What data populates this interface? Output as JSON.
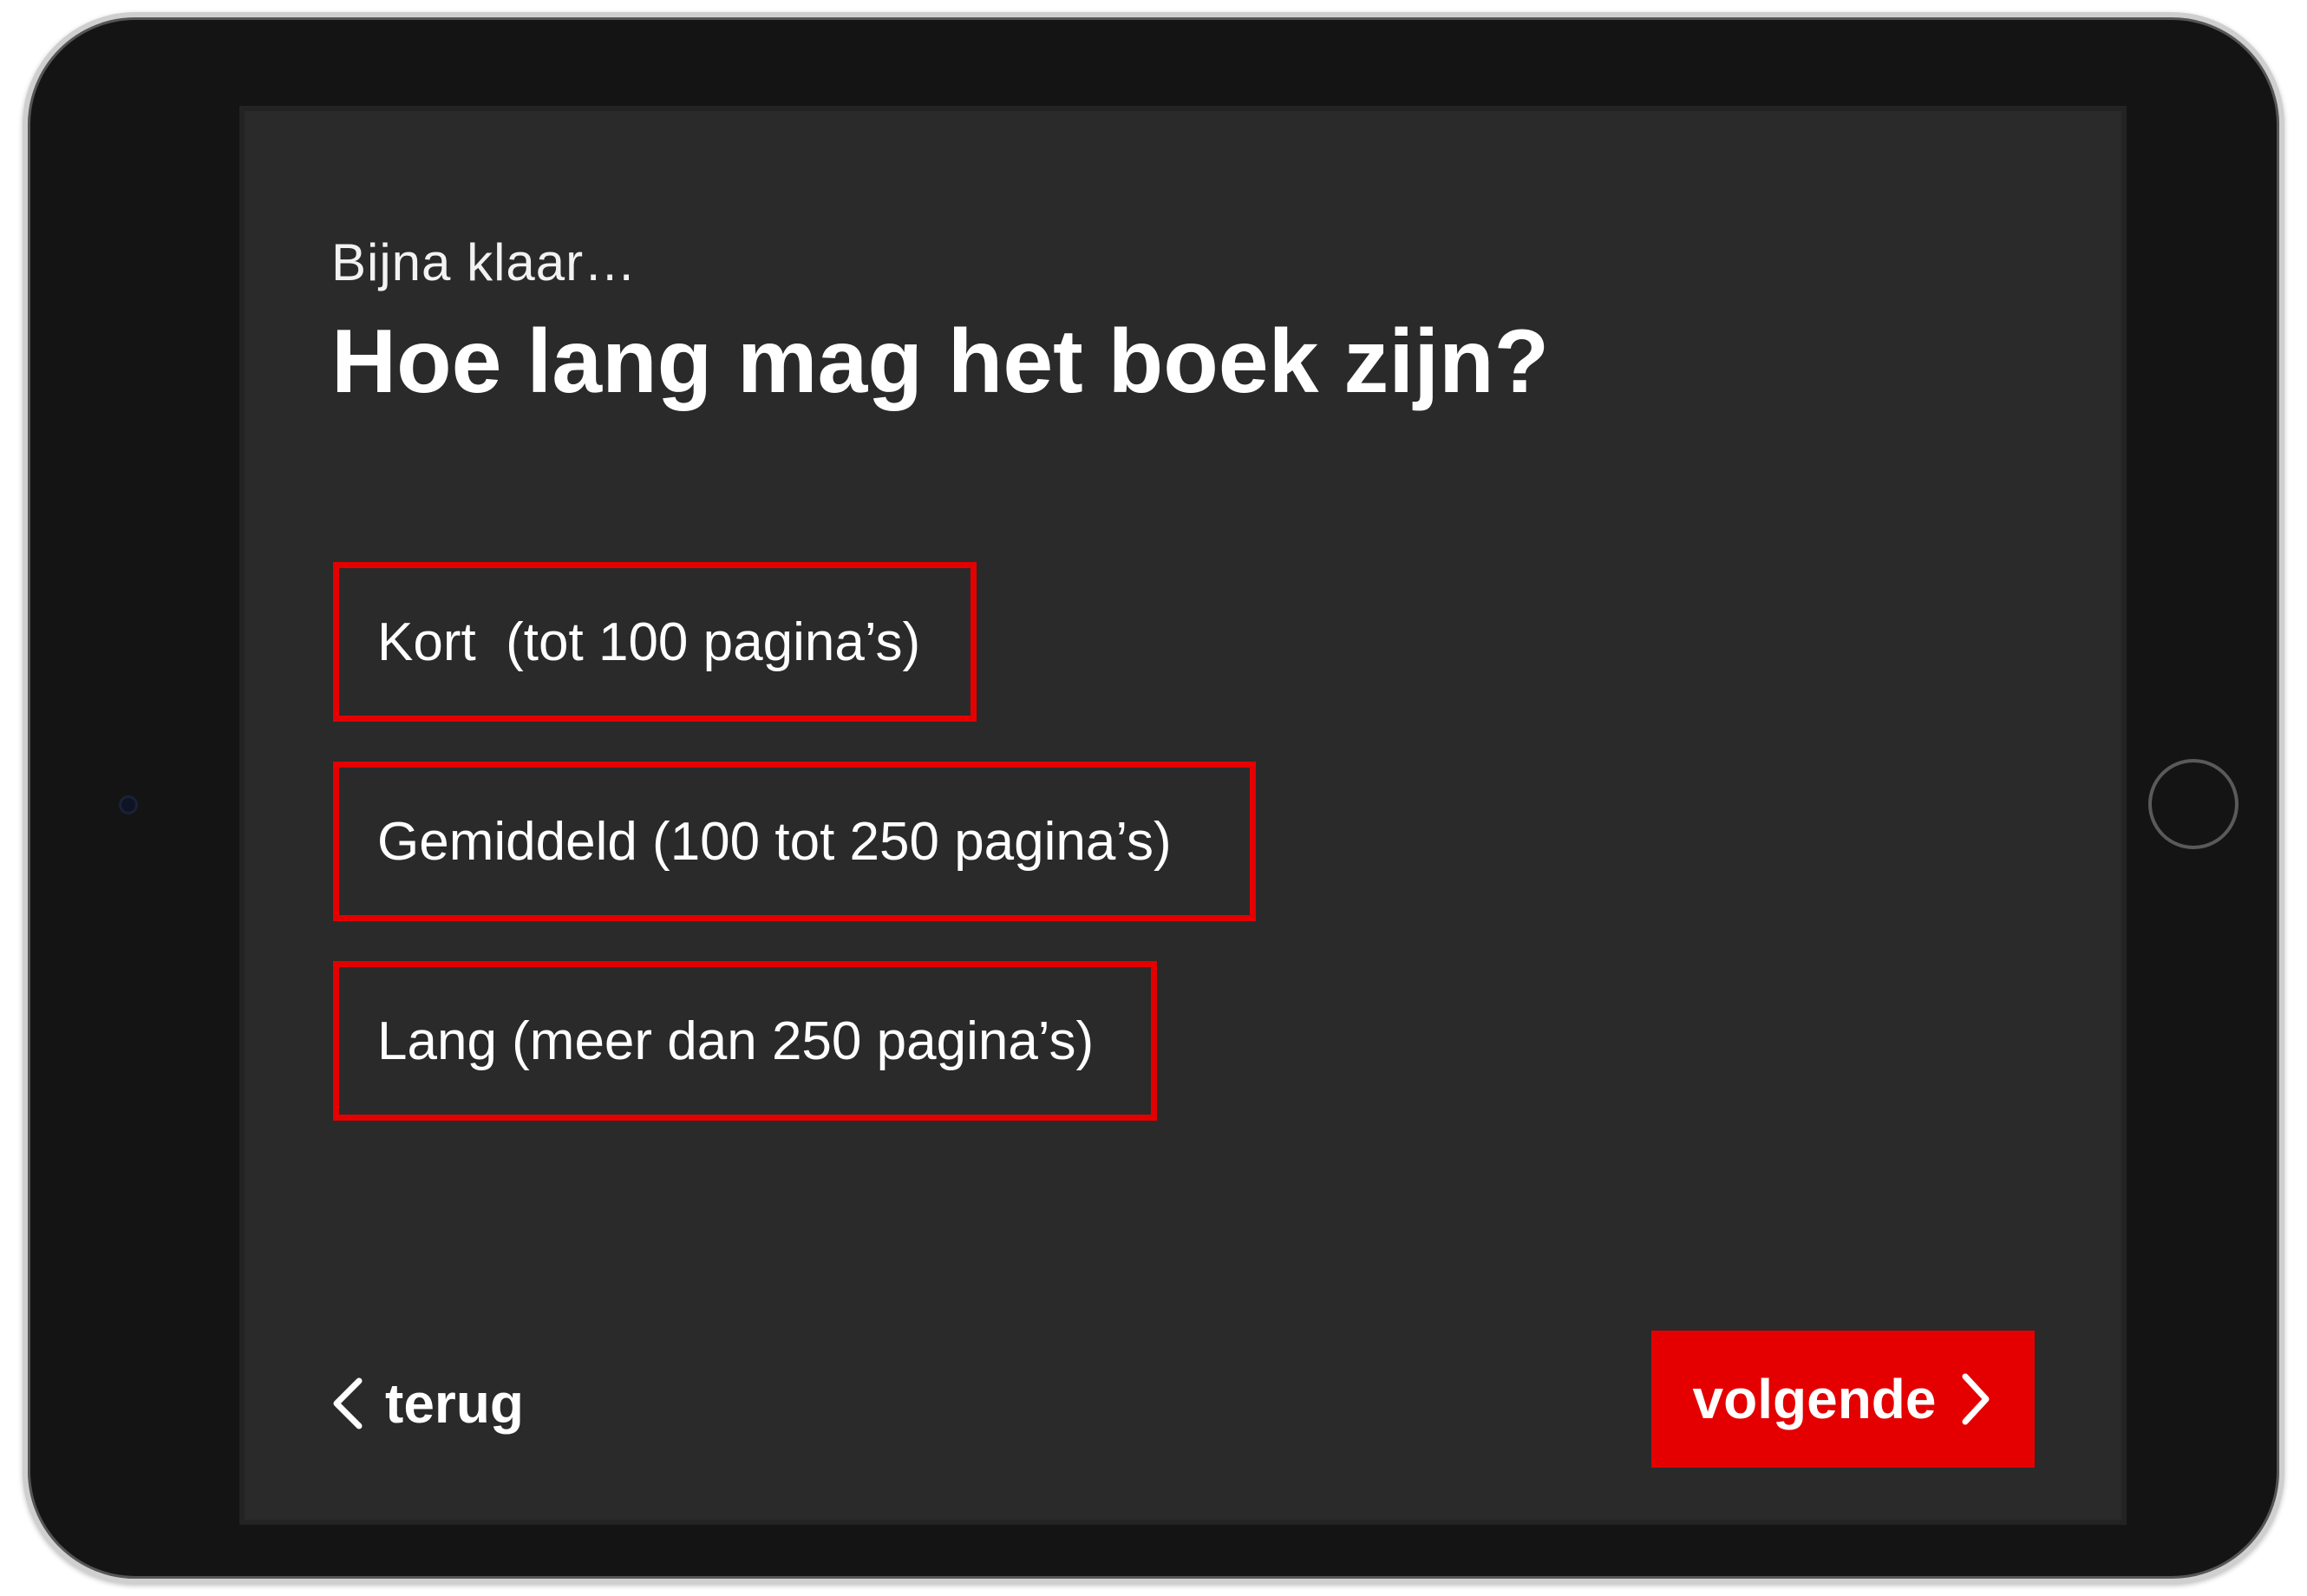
{
  "header": {
    "subtitle": "Bijna klaar…",
    "question": "Hoe lang mag het boek zijn?"
  },
  "options": [
    {
      "label": "Kort  (tot 100 pagina’s)"
    },
    {
      "label": "Gemiddeld (100 tot 250 pagina’s)"
    },
    {
      "label": "Lang (meer dan 250 pagina’s)"
    }
  ],
  "navigation": {
    "back_label": "terug",
    "next_label": "volgende",
    "back_icon": "chevron-left-icon",
    "next_icon": "chevron-right-icon"
  },
  "colors": {
    "accent": "#e40000",
    "screen_background": "#2a2a2a",
    "text": "#ffffff"
  }
}
